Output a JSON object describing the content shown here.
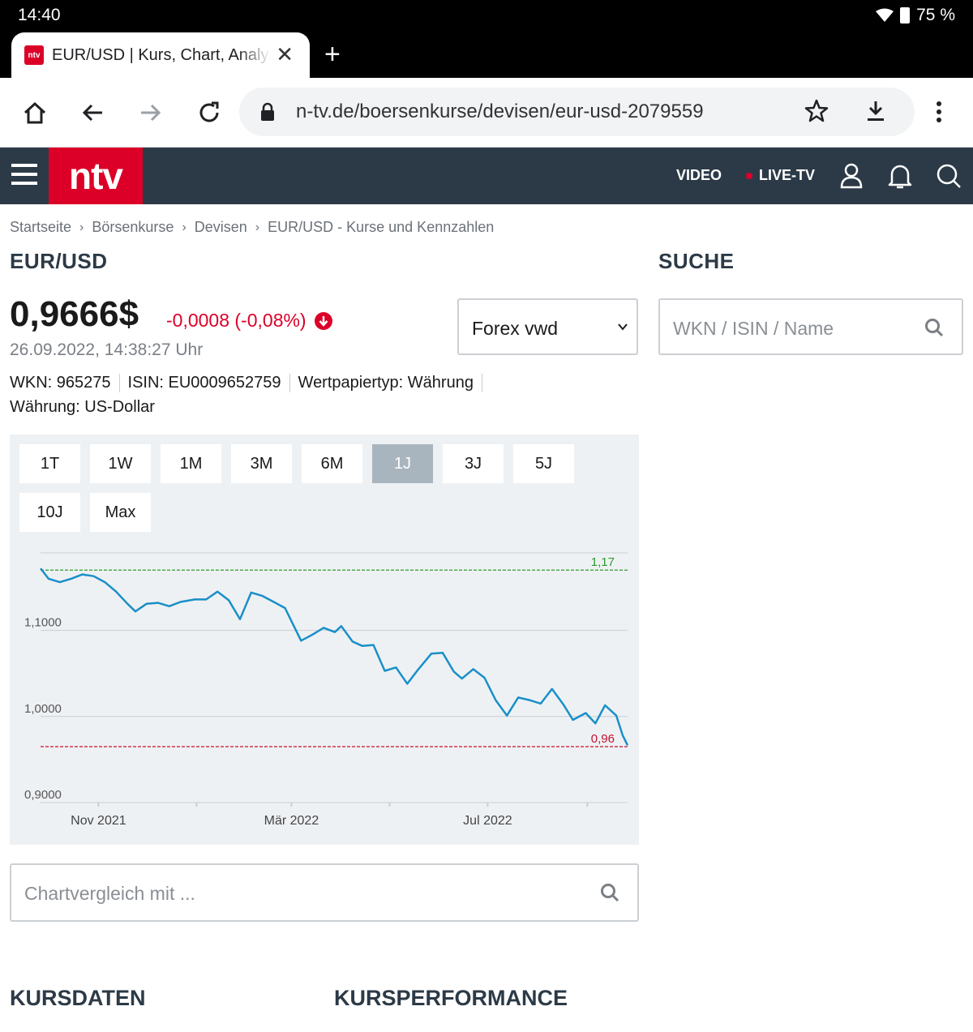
{
  "status": {
    "time": "14:40",
    "battery": "75 %"
  },
  "tab": {
    "title": "EUR/USD | Kurs, Chart, Analysen",
    "favicon_label": "ntv"
  },
  "omnibox": {
    "url": "n-tv.de/boersenkurse/devisen/eur-usd-2079559"
  },
  "sitenav": {
    "logo": "ntv",
    "video": "VIDEO",
    "live": "LIVE-TV"
  },
  "breadcrumb": [
    "Startseite",
    "Börsenkurse",
    "Devisen",
    "EUR/USD - Kurse und Kennzahlen"
  ],
  "instrument": {
    "title": "EUR/USD",
    "price": "0,9666$",
    "change": "-0,0008 (-0,08%)",
    "datetime": "26.09.2022, 14:38:27 Uhr",
    "wkn": "WKN: 965275",
    "isin": "ISIN: EU0009652759",
    "type": "Wertpapiertyp: Währung",
    "currency": "Währung: US-Dollar",
    "exchange": "Forex vwd"
  },
  "search": {
    "heading": "SUCHE",
    "placeholder": "WKN / ISIN / Name"
  },
  "ranges": [
    "1T",
    "1W",
    "1M",
    "3M",
    "6M",
    "1J",
    "3J",
    "5J",
    "10J",
    "Max"
  ],
  "active_range": "1J",
  "compare": {
    "placeholder": "Chartvergleich mit ..."
  },
  "sections": {
    "kursdaten": "KURSDATEN",
    "kursperformance": "KURSPERFORMANCE"
  },
  "colors": {
    "line": "#1a8fc8",
    "high": "#2a9d2a",
    "low": "#c8102e",
    "brand": "#dc0028",
    "nav": "#2c3a47"
  },
  "chart_data": {
    "type": "line",
    "title": "",
    "xlabel": "",
    "ylabel": "",
    "ylim": [
      0.9,
      1.19
    ],
    "yticks": [
      {
        "v": 1.1,
        "label": "1,1000"
      },
      {
        "v": 1.0,
        "label": "1,0000"
      },
      {
        "v": 0.9,
        "label": "0,9000"
      }
    ],
    "xticks": [
      {
        "d": "2021-11-01",
        "label": "Nov 2021"
      },
      {
        "d": "2022-03-01",
        "label": "Mär 2022"
      },
      {
        "d": "2022-07-01",
        "label": "Jul 2022"
      }
    ],
    "xrange": [
      "2021-09-26",
      "2022-09-26"
    ],
    "high": {
      "value": 1.17,
      "label": "1,17"
    },
    "low": {
      "value": 0.965,
      "label": "0,96"
    },
    "series": [
      {
        "values": [
          [
            "2021-09-26",
            1.172
          ],
          [
            "2021-10-01",
            1.16
          ],
          [
            "2021-10-08",
            1.156
          ],
          [
            "2021-10-15",
            1.16
          ],
          [
            "2021-10-22",
            1.165
          ],
          [
            "2021-10-29",
            1.163
          ],
          [
            "2021-11-05",
            1.156
          ],
          [
            "2021-11-12",
            1.145
          ],
          [
            "2021-11-19",
            1.131
          ],
          [
            "2021-11-24",
            1.122
          ],
          [
            "2021-12-01",
            1.131
          ],
          [
            "2021-12-08",
            1.132
          ],
          [
            "2021-12-15",
            1.128
          ],
          [
            "2021-12-22",
            1.133
          ],
          [
            "2021-12-31",
            1.136
          ],
          [
            "2022-01-07",
            1.136
          ],
          [
            "2022-01-14",
            1.145
          ],
          [
            "2022-01-21",
            1.135
          ],
          [
            "2022-01-28",
            1.113
          ],
          [
            "2022-02-04",
            1.144
          ],
          [
            "2022-02-11",
            1.14
          ],
          [
            "2022-02-18",
            1.133
          ],
          [
            "2022-02-25",
            1.126
          ],
          [
            "2022-03-07",
            1.088
          ],
          [
            "2022-03-14",
            1.095
          ],
          [
            "2022-03-21",
            1.103
          ],
          [
            "2022-03-28",
            1.098
          ],
          [
            "2022-04-01",
            1.105
          ],
          [
            "2022-04-08",
            1.087
          ],
          [
            "2022-04-14",
            1.082
          ],
          [
            "2022-04-21",
            1.083
          ],
          [
            "2022-04-28",
            1.053
          ],
          [
            "2022-05-05",
            1.057
          ],
          [
            "2022-05-12",
            1.038
          ],
          [
            "2022-05-19",
            1.055
          ],
          [
            "2022-05-27",
            1.073
          ],
          [
            "2022-06-03",
            1.074
          ],
          [
            "2022-06-10",
            1.052
          ],
          [
            "2022-06-15",
            1.044
          ],
          [
            "2022-06-22",
            1.055
          ],
          [
            "2022-06-29",
            1.045
          ],
          [
            "2022-07-06",
            1.019
          ],
          [
            "2022-07-13",
            1.001
          ],
          [
            "2022-07-20",
            1.022
          ],
          [
            "2022-07-27",
            1.019
          ],
          [
            "2022-08-03",
            1.015
          ],
          [
            "2022-08-10",
            1.032
          ],
          [
            "2022-08-17",
            1.014
          ],
          [
            "2022-08-23",
            0.996
          ],
          [
            "2022-08-31",
            1.004
          ],
          [
            "2022-09-06",
            0.992
          ],
          [
            "2022-09-12",
            1.013
          ],
          [
            "2022-09-19",
            1.001
          ],
          [
            "2022-09-23",
            0.978
          ],
          [
            "2022-09-26",
            0.9666
          ]
        ]
      }
    ]
  }
}
